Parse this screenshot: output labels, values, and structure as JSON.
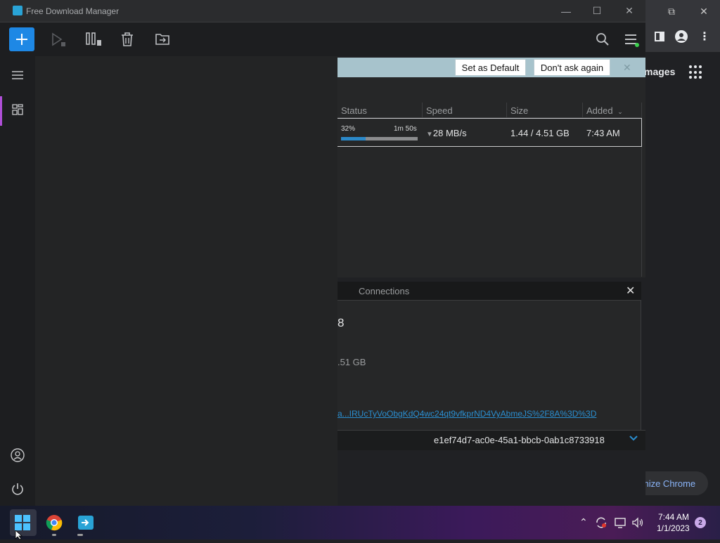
{
  "chrome": {
    "images_link": "mages",
    "customize_label": "Customize Chrome"
  },
  "fdm": {
    "window_title": "Free Download Manager",
    "banner": {
      "set_default_label": "Set as Default",
      "dont_ask_label": "Don't ask again"
    },
    "columns": [
      "Status",
      "Speed",
      "Size",
      "Added"
    ],
    "download": {
      "progress_percent": "32%",
      "progress_fraction": 0.32,
      "time_remaining": "1m 50s",
      "speed": "28 MB/s",
      "size": "1.44 / 4.51 GB",
      "added": "7:43 AM"
    },
    "details": {
      "tab_connections": "Connections",
      "big_value": "8",
      "size_value": ".51 GB",
      "link_text": "a...IRUcTyVoObgKdQ4wc24qt9vfkprND4VyAbmeJS%2F8A%3D%3D",
      "id_value": "e1ef74d7-ac0e-45a1-bbcb-0ab1c8733918"
    }
  },
  "taskbar": {
    "clock_time": "7:44 AM",
    "clock_date": "1/1/2023",
    "notification_count": "2"
  },
  "colors": {
    "accent": "#1e88e5",
    "progress": "#2b89c9",
    "sidebar_active": "#b04fd8",
    "link": "#2a8fd1"
  }
}
